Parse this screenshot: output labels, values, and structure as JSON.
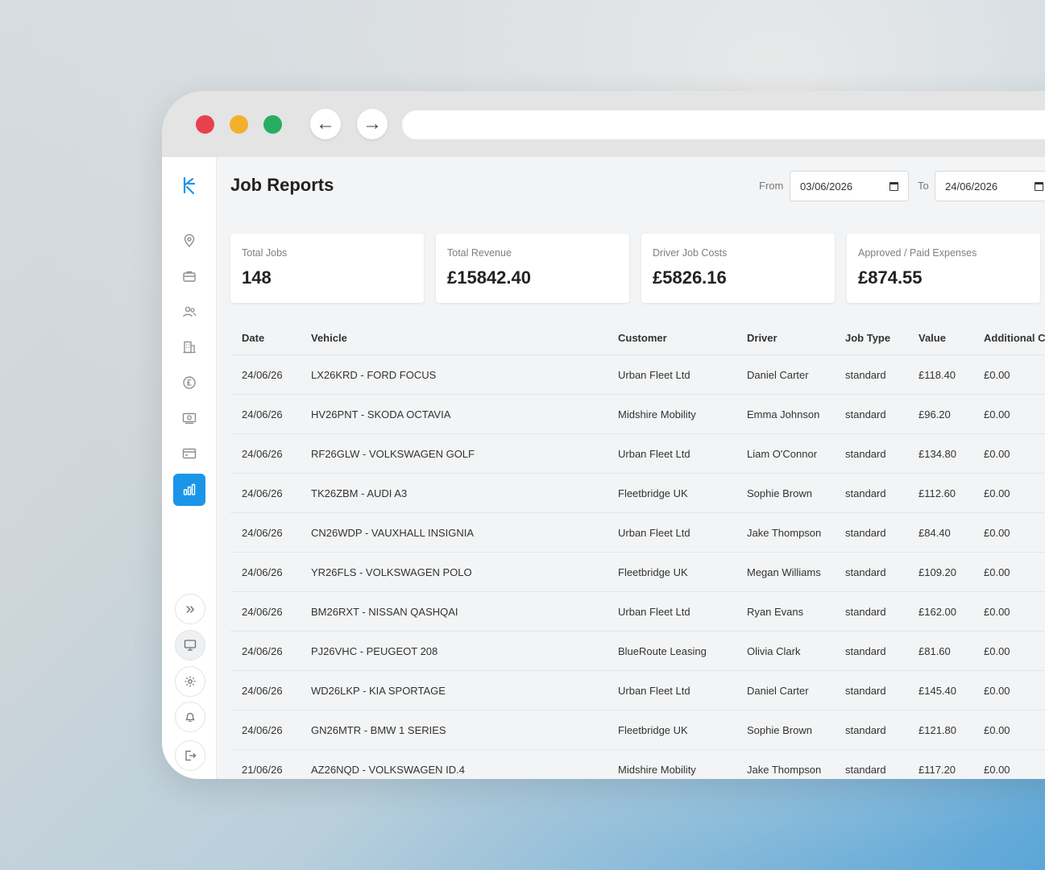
{
  "colors": {
    "accent": "#1a96e8",
    "close": "#e8404f",
    "minimize": "#f1b12d",
    "maximize": "#27ae60"
  },
  "browser": {
    "back_icon": "arrow-left-icon",
    "forward_icon": "arrow-right-icon",
    "back_glyph": "←",
    "forward_glyph": "→"
  },
  "sidebar": {
    "items": [
      {
        "name": "location-icon"
      },
      {
        "name": "briefcase-icon"
      },
      {
        "name": "users-icon"
      },
      {
        "name": "building-icon"
      },
      {
        "name": "pound-icon"
      },
      {
        "name": "money-icon"
      },
      {
        "name": "card-icon"
      },
      {
        "name": "chart-icon",
        "active": true
      }
    ],
    "bottom": [
      {
        "name": "expand-icon",
        "glyph": "»"
      },
      {
        "name": "monitor-icon",
        "glyph": "▭"
      },
      {
        "name": "gear-icon",
        "glyph": "⚙"
      },
      {
        "name": "bell-icon",
        "glyph": "🔔"
      },
      {
        "name": "logout-icon",
        "glyph": "⇥"
      }
    ]
  },
  "header": {
    "title": "Job Reports",
    "from_label": "From",
    "from_value": "03/06/2026",
    "to_label": "To",
    "to_value": "24/06/2026"
  },
  "cards": [
    {
      "label": "Total Jobs",
      "value": "148"
    },
    {
      "label": "Total Revenue",
      "value": "£15842.40"
    },
    {
      "label": "Driver Job Costs",
      "value": "£5826.16"
    },
    {
      "label": "Approved / Paid Expenses",
      "value": "£874.55"
    }
  ],
  "table": {
    "columns": [
      "Date",
      "Vehicle",
      "Customer",
      "Driver",
      "Job Type",
      "Value",
      "Additional C"
    ],
    "rows": [
      [
        "24/06/26",
        "LX26KRD - FORD FOCUS",
        "Urban Fleet Ltd",
        "Daniel Carter",
        "standard",
        "£118.40",
        "£0.00"
      ],
      [
        "24/06/26",
        "HV26PNT - SKODA OCTAVIA",
        "Midshire Mobility",
        "Emma Johnson",
        "standard",
        "£96.20",
        "£0.00"
      ],
      [
        "24/06/26",
        "RF26GLW - VOLKSWAGEN GOLF",
        "Urban Fleet Ltd",
        "Liam O'Connor",
        "standard",
        "£134.80",
        "£0.00"
      ],
      [
        "24/06/26",
        "TK26ZBM - AUDI A3",
        "Fleetbridge UK",
        "Sophie Brown",
        "standard",
        "£112.60",
        "£0.00"
      ],
      [
        "24/06/26",
        "CN26WDP - VAUXHALL INSIGNIA",
        "Urban Fleet Ltd",
        "Jake Thompson",
        "standard",
        "£84.40",
        "£0.00"
      ],
      [
        "24/06/26",
        "YR26FLS - VOLKSWAGEN POLO",
        "Fleetbridge UK",
        "Megan Williams",
        "standard",
        "£109.20",
        "£0.00"
      ],
      [
        "24/06/26",
        "BM26RXT - NISSAN QASHQAI",
        "Urban Fleet Ltd",
        "Ryan Evans",
        "standard",
        "£162.00",
        "£0.00"
      ],
      [
        "24/06/26",
        "PJ26VHC - PEUGEOT 208",
        "BlueRoute Leasing",
        "Olivia Clark",
        "standard",
        "£81.60",
        "£0.00"
      ],
      [
        "24/06/26",
        "WD26LKP - KIA SPORTAGE",
        "Urban Fleet Ltd",
        "Daniel Carter",
        "standard",
        "£145.40",
        "£0.00"
      ],
      [
        "24/06/26",
        "GN26MTR - BMW 1 SERIES",
        "Fleetbridge UK",
        "Sophie Brown",
        "standard",
        "£121.80",
        "£0.00"
      ],
      [
        "21/06/26",
        "AZ26NQD - VOLKSWAGEN ID.4",
        "Midshire Mobility",
        "Jake Thompson",
        "standard",
        "£117.20",
        "£0.00"
      ]
    ]
  }
}
